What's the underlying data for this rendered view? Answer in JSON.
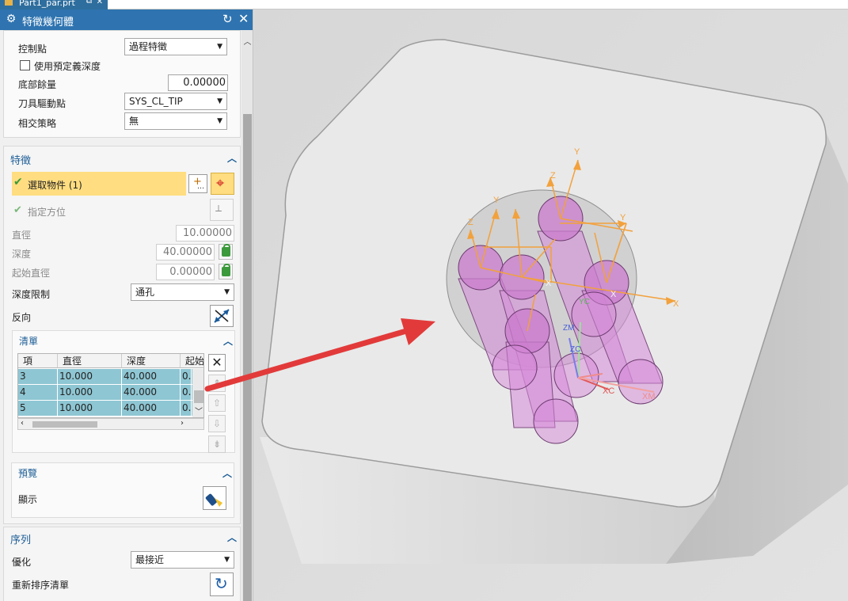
{
  "tab": {
    "title": "Part1_par.prt"
  },
  "dialog": {
    "title": "特徵幾何體",
    "settings": {
      "control_point_label": "控制點",
      "control_point_value": "過程特徵",
      "use_predefined_depth_label": "使用預定義深度",
      "bottom_stock_label": "底部餘量",
      "bottom_stock_value": "0.00000",
      "tool_drive_point_label": "刀具驅動點",
      "tool_drive_point_value": "SYS_CL_TIP",
      "intersect_strategy_label": "相交策略",
      "intersect_strategy_value": "無"
    },
    "features": {
      "header": "特徵",
      "select_object_label": "選取物件 (1)",
      "specify_orientation_label": "指定方位",
      "diameter_label": "直徑",
      "diameter_value": "10.00000",
      "depth_label": "深度",
      "depth_value": "40.00000",
      "start_diameter_label": "起始直徑",
      "start_diameter_value": "0.00000",
      "depth_limit_label": "深度限制",
      "depth_limit_value": "通孔",
      "reverse_label": "反向"
    },
    "list": {
      "header": "清單",
      "columns": [
        "項",
        "直徑",
        "深度",
        "起始"
      ],
      "rows": [
        [
          "3",
          "10.000",
          "40.000",
          "0."
        ],
        [
          "4",
          "10.000",
          "40.000",
          "0."
        ],
        [
          "5",
          "10.000",
          "40.000",
          "0."
        ]
      ]
    },
    "preview": {
      "header": "預覽",
      "show_label": "顯示"
    },
    "sequence": {
      "header": "序列",
      "optimize_label": "優化",
      "optimize_value": "最接近",
      "reorder_label": "重新排序清單"
    }
  },
  "viewport_labels": {
    "y_axis": "Y",
    "z_axis": "Z",
    "x_axis": "X",
    "xc": "XC",
    "xm": "XM",
    "zm": "ZM",
    "zc": "ZC",
    "yc": "YC"
  },
  "colors": {
    "accent": "#2f74b0",
    "selection": "#ffdd80",
    "table_row": "#8ec6d3",
    "cylinder": "#d58ad8",
    "axis": "#f2a13c",
    "arrow": "#e23a3a"
  }
}
